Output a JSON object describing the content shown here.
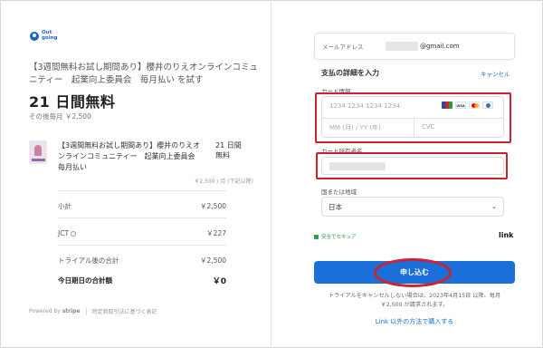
{
  "brand": {
    "logo_text_top": "Out",
    "logo_text_bottom": "going"
  },
  "summary": {
    "product_name": "【3週間無料お試し期間あり】櫻井のりえオンラインコミュニティー　起業向上委員会　毎月払い を試す",
    "price_headline": "21 日間無料",
    "price_after": "その後毎月 ￥2,500"
  },
  "line_item": {
    "title": "【3週間無料お試し期間あり】櫻井のりえオンラインコミュニティー　起業向上委員会　毎月払い",
    "days": "21 日間無料",
    "unit_price": "￥2,500 / 月 (下記以降)"
  },
  "totals": {
    "subtotal_label": "小計",
    "subtotal_value": "￥2,500",
    "tax_label": "JCT",
    "tax_value": "￥227",
    "after_trial_label": "トライアル後の合計",
    "after_trial_value": "￥2,500",
    "today_label": "今日期日の合計額",
    "today_value": "￥0"
  },
  "footer": {
    "powered_by": "Powered by",
    "stripe": "stripe",
    "legal": "特定商取引法に基づく表記"
  },
  "form": {
    "email_label": "メールアドレス",
    "email_value": "@gmail.com",
    "section_title": "支払の詳細を入力",
    "cancel_label": "キャンセル",
    "card_label": "カード情報",
    "card_number_placeholder": "1234 1234 1234 1234",
    "card_expiry_placeholder": "MM (月) / YY (年)",
    "card_cvc_placeholder": "CVC",
    "card_brands": [
      "JCB",
      "VISA",
      "MC",
      "AMEX"
    ],
    "cardholder_label": "カード所有者名",
    "country_label": "国または地域",
    "country_value": "日本",
    "secure_label": "安全でセキュア",
    "link_brand": "link",
    "submit_label": "申し込む",
    "notice": "トライアルをキャンセルしない場合は、2023年4月15日 以降、毎月 ￥2,500 が請求されます。",
    "alt_payment_label": "Link 以外の方法で購入する"
  },
  "colors": {
    "accent": "#1b6fd9",
    "highlight": "#d11f2c",
    "secure": "#2f9d4e"
  }
}
